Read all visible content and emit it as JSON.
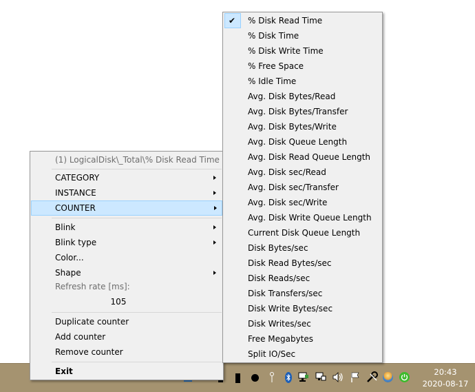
{
  "main_menu": {
    "header": "(1) LogicalDisk\\_Total\\% Disk Read Time",
    "category": "CATEGORY",
    "instance": "INSTANCE",
    "counter": "COUNTER",
    "blink": "Blink",
    "blink_type": "Blink type",
    "color": "Color...",
    "shape": "Shape",
    "refresh_label": "Refresh rate [ms]:",
    "refresh_value": "105",
    "duplicate": "Duplicate counter",
    "add": "Add counter",
    "remove": "Remove counter",
    "exit": "Exit"
  },
  "counter_menu": {
    "checked_item": "% Disk Read Time",
    "items": [
      "% Disk Read Time",
      "% Disk Time",
      "% Disk Write Time",
      "% Free Space",
      "% Idle Time",
      "Avg. Disk Bytes/Read",
      "Avg. Disk Bytes/Transfer",
      "Avg. Disk Bytes/Write",
      "Avg. Disk Queue Length",
      "Avg. Disk Read Queue Length",
      "Avg. Disk sec/Read",
      "Avg. Disk sec/Transfer",
      "Avg. Disk sec/Write",
      "Avg. Disk Write Queue Length",
      "Current Disk Queue Length",
      "Disk Bytes/sec",
      "Disk Read Bytes/sec",
      "Disk Reads/sec",
      "Disk Transfers/sec",
      "Disk Write Bytes/sec",
      "Disk Writes/sec",
      "Free Megabytes",
      "Split IO/Sec"
    ]
  },
  "taskbar": {
    "time": "20:43",
    "date": "2020-08-17",
    "tray_icons": [
      "blue-square-icon",
      "black-rect-icon",
      "black-rect-icon",
      "black-circle-icon",
      "pin-icon",
      "bluetooth-icon",
      "network-icon",
      "network-icon",
      "volume-icon",
      "flag-icon",
      "tools-icon",
      "orb-icon",
      "power-icon"
    ],
    "colors": {
      "taskbar": "#a59370",
      "highlight": "#cce8ff",
      "highlight_border": "#99d1ff",
      "menu_bg": "#f0f0f0"
    }
  }
}
